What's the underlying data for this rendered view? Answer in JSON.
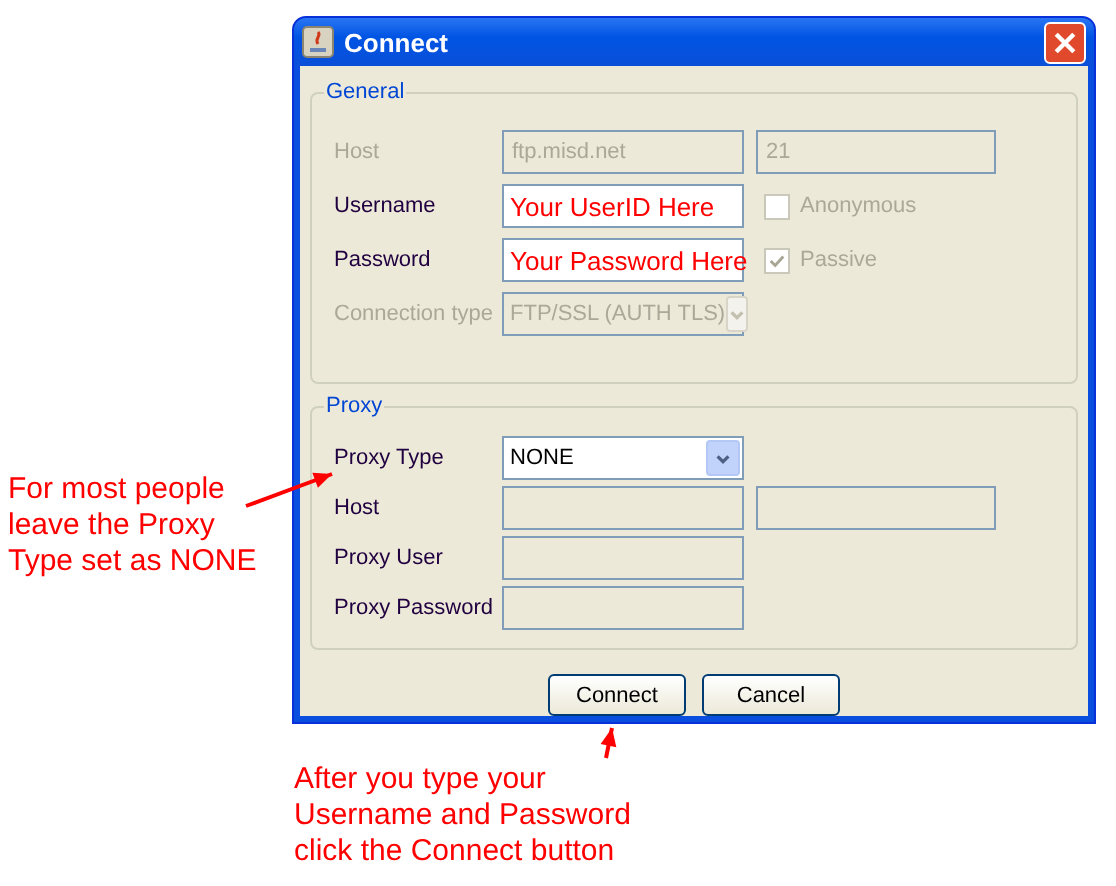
{
  "window": {
    "title": "Connect"
  },
  "general": {
    "legend": "General",
    "rows": [
      {
        "kind": "pair",
        "label": "Host",
        "disabled": true,
        "value": "ftp.misd.net",
        "value_2": "21"
      },
      {
        "kind": "text_check",
        "label": "Username",
        "disabled": false,
        "value": "Your UserID Here",
        "check": {
          "label": "Anonymous",
          "checked": false,
          "disabled": true
        }
      },
      {
        "kind": "text_check",
        "label": "Password",
        "disabled": false,
        "value": "Your Password Here",
        "check": {
          "label": "Passive",
          "checked": true,
          "disabled": true
        }
      },
      {
        "kind": "select",
        "label": "Connection type",
        "disabled": true,
        "value": "FTP/SSL (AUTH TLS)"
      }
    ]
  },
  "proxy": {
    "legend": "Proxy",
    "rows": [
      {
        "kind": "select",
        "label": "Proxy Type",
        "disabled": false,
        "value": "NONE"
      },
      {
        "kind": "pair",
        "label": "Host",
        "editable": false
      },
      {
        "kind": "text",
        "label": "Proxy User",
        "editable": false
      },
      {
        "kind": "text",
        "label": "Proxy Password",
        "editable": false
      }
    ]
  },
  "buttons": [
    "Connect",
    "Cancel"
  ],
  "annotations": [
    {
      "text": "For most people\nleave the Proxy\nType set as NONE",
      "kind": "side"
    },
    {
      "text": "After you type your\nUsername and Password\nclick the Connect button",
      "kind": "below"
    }
  ]
}
